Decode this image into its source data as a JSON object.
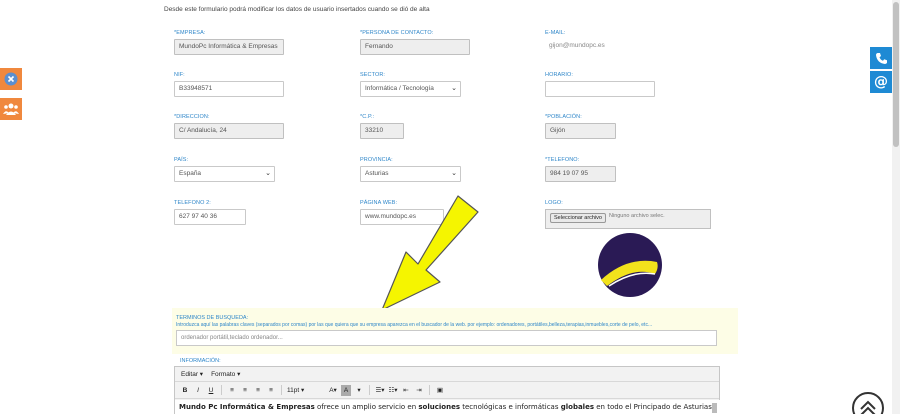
{
  "intro_text": "Desde este formulario podrá modificar los datos de usuario insertados cuando se dió de alta",
  "fields": {
    "empresa": {
      "label": "*EMPRESA:",
      "value": "MundoPc Informática & Empresas"
    },
    "contacto": {
      "label": "*PERSONA DE CONTACTO:",
      "value": "Fernando"
    },
    "email": {
      "label": "E-MAIL:",
      "value": "gijon@mundopc.es"
    },
    "nif": {
      "label": "NIF:",
      "value": "B33948571"
    },
    "sector": {
      "label": "SECTOR:",
      "value": "Informática / Tecnología"
    },
    "horario": {
      "label": "HORARIO:",
      "value": ""
    },
    "direccion": {
      "label": "*DIRECCION:",
      "value": "C/ Andalucía, 24"
    },
    "cp": {
      "label": "*C.P.:",
      "value": "33210"
    },
    "poblacion": {
      "label": "*POBLACIÓN:",
      "value": "Gijón"
    },
    "pais": {
      "label": "PAÍS:",
      "value": "España"
    },
    "provincia": {
      "label": "PROVINCIA:",
      "value": "Asturias"
    },
    "telefono": {
      "label": "*TELEFONO:",
      "value": "984 19 07 95"
    },
    "telefono2": {
      "label": "TELEFONO 2:",
      "value": "627 97 40 36"
    },
    "web": {
      "label": "PÁGINA WEB:",
      "value": "www.mundopc.es"
    },
    "logo": {
      "label": "LOGO:",
      "button": "Seleccionar archivo",
      "status": "Ninguno archivo selec."
    }
  },
  "terms": {
    "label": "TERMINOS DE BUSQUEDA:",
    "hint": "Introduzca aquí las palabras claves (separados por comas) por las que quiera que su empresa aparezca en el buscador de la web. por ejemplo: ordenadores, portátiles,belleza,terapias,inmuebles,corte de pelo, etc...",
    "placeholder": "ordenador portátil,teclado ordenador..."
  },
  "info": {
    "label": "INFORMACIÓN:",
    "menu": [
      "Editar ▾",
      "Formato ▾"
    ],
    "font_size": "11pt",
    "content_bold_1": "Mundo Pc Informática & Empresas",
    "content_1": " ofrece un amplio servicio en ",
    "content_bold_2": "soluciones",
    "content_2": " tecnológicas e informáticas ",
    "content_bold_3": "globales",
    "content_3": " en todo el Principado de Asturias."
  },
  "icons": {
    "left_top": "close-icon",
    "left_bottom": "users-icon",
    "right_top": "phone-icon",
    "right_bottom": "at-icon",
    "bottom_right": "scroll-top-icon"
  },
  "colors": {
    "accent_blue": "#1e8ad4",
    "label_blue": "#2e86c9",
    "orange": "#f0883e",
    "arrow_yellow": "#f5f500",
    "logo_purple": "#2a1a55"
  }
}
